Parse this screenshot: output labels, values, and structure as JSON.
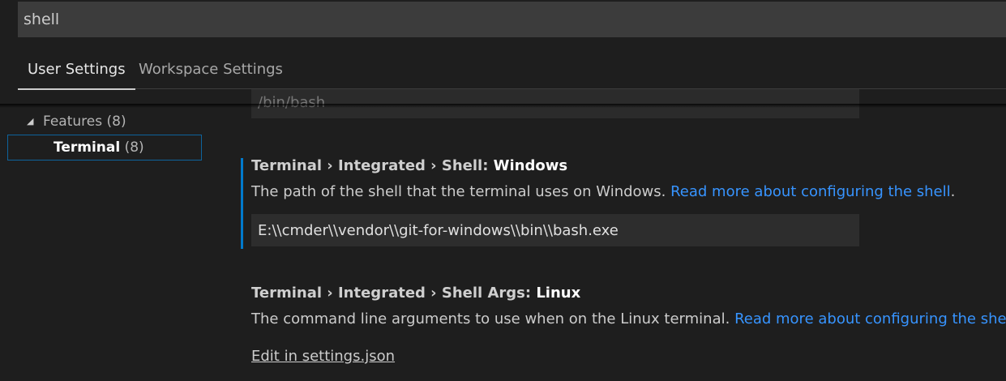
{
  "search": {
    "value": "shell"
  },
  "tabs": [
    {
      "label": "User Settings",
      "active": true
    },
    {
      "label": "Workspace Settings",
      "active": false
    }
  ],
  "toc": {
    "features": {
      "label": "Features",
      "count": "(8)"
    },
    "terminal": {
      "label": "Terminal",
      "count": "(8)"
    }
  },
  "previous_setting": {
    "value_fragment": "/bin/bash"
  },
  "settings": [
    {
      "category": "Terminal › Integrated › Shell: ",
      "key": "Windows",
      "description": "The path of the shell that the terminal uses on Windows. ",
      "link": "Read more about configuring the shell",
      "link_after": ".",
      "value": "E:\\\\cmder\\\\vendor\\\\git-for-windows\\\\bin\\\\bash.exe"
    },
    {
      "category": "Terminal › Integrated › Shell Args: ",
      "key": "Linux",
      "description": "The command line arguments to use when on the Linux terminal. ",
      "link": "Read more about configuring the shell",
      "link_after": ".",
      "edit_link": "Edit in settings.json"
    }
  ],
  "colors": {
    "accent": "#007acc",
    "link": "#3794ff",
    "background": "#1e1e1e"
  }
}
